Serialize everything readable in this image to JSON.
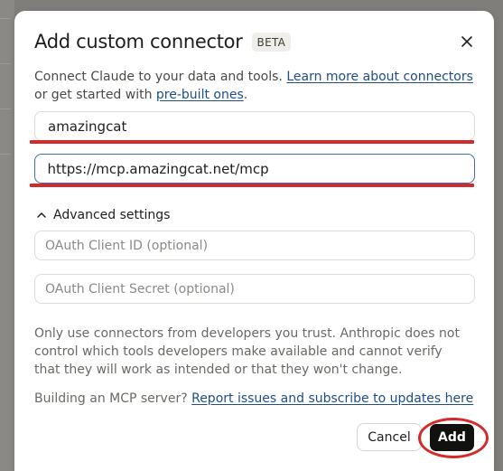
{
  "dialog": {
    "title": "Add custom connector",
    "badge": "BETA",
    "close_icon": "close-icon"
  },
  "intro": {
    "text_before": "Connect Claude to your data and tools. ",
    "learn_more_link": "Learn more about connectors",
    "text_middle": " or get started with ",
    "prebuilt_link": "pre-built ones",
    "text_after": "."
  },
  "fields": {
    "name_value": "amazingcat",
    "url_value": "https://mcp.amazingcat.net/mcp"
  },
  "advanced": {
    "label": "Advanced settings",
    "icon": "chevron-up-icon",
    "client_id_placeholder": "OAuth Client ID (optional)",
    "client_secret_placeholder": "OAuth Client Secret (optional)"
  },
  "warning_text": "Only use connectors from developers you trust. Anthropic does not control which tools developers make available and cannot verify that they will work as intended or that they won't change.",
  "building": {
    "text": "Building an MCP server? ",
    "link": "Report issues and subscribe to updates here"
  },
  "buttons": {
    "cancel": "Cancel",
    "add": "Add"
  },
  "colors": {
    "link": "#1d4d8c",
    "focus_border": "#3b6fb7",
    "annotation_red": "#d42a2a",
    "primary_button": "#111110"
  }
}
